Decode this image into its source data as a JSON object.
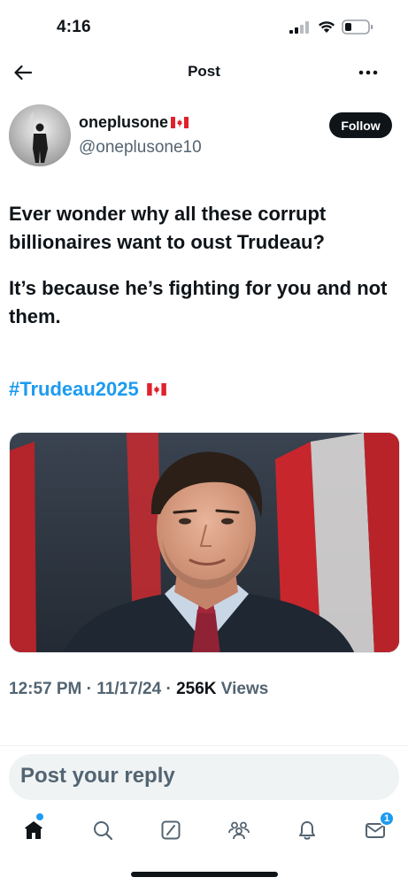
{
  "status_bar": {
    "time": "4:16"
  },
  "header": {
    "title": "Post"
  },
  "author": {
    "display_name": "oneplusone",
    "handle": "@oneplusone10",
    "follow_label": "Follow"
  },
  "tweet": {
    "paragraph_1": "Ever wonder why all these corrupt billionaires want to oust Trudeau?",
    "paragraph_2": "It’s because he’s fighting for you and not them.",
    "hashtag": "#Trudeau2025"
  },
  "meta": {
    "time": "12:57 PM",
    "sep1": " · ",
    "date": "11/17/24",
    "sep2": " · ",
    "views_count": "256K",
    "views_label": "Views"
  },
  "reply": {
    "placeholder": "Post your reply"
  },
  "bottom_nav": {
    "messages_badge": "1"
  },
  "colors": {
    "accent": "#1d9bf0",
    "text": "#0f1419",
    "secondary": "#536471"
  }
}
